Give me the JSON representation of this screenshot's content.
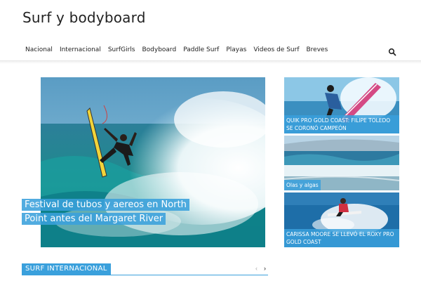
{
  "site": {
    "title": "Surf y bodyboard"
  },
  "nav": {
    "items": [
      "Nacional",
      "Internacional",
      "SurfGirls",
      "Bodyboard",
      "Paddle Surf",
      "Playas",
      "Videos de Surf",
      "Breves"
    ],
    "search_icon": "search-icon"
  },
  "hero": {
    "caption": "Festival de tubos y aereos en North Point antes del Margaret River",
    "image": "surfer-aerial-wave-photo"
  },
  "side_cards": [
    {
      "caption": "QUIK PRO GOLD COAST: FILIPE TOLEDO SE CORONÓ CAMPEÓN",
      "image": "surfer-turn-photo"
    },
    {
      "caption": "Olas y algas",
      "image": "beach-waves-photo"
    },
    {
      "caption": "CARISSA MOORE SE LLEVÓ EL ROXY PRO GOLD COAST",
      "image": "surfer-spray-photo"
    }
  ],
  "section": {
    "title": "SURF INTERNACIONAL",
    "prev_icon": "chevron-left-icon",
    "next_icon": "chevron-right-icon"
  },
  "colors": {
    "accent": "#3aa0dc",
    "text": "#222222"
  }
}
